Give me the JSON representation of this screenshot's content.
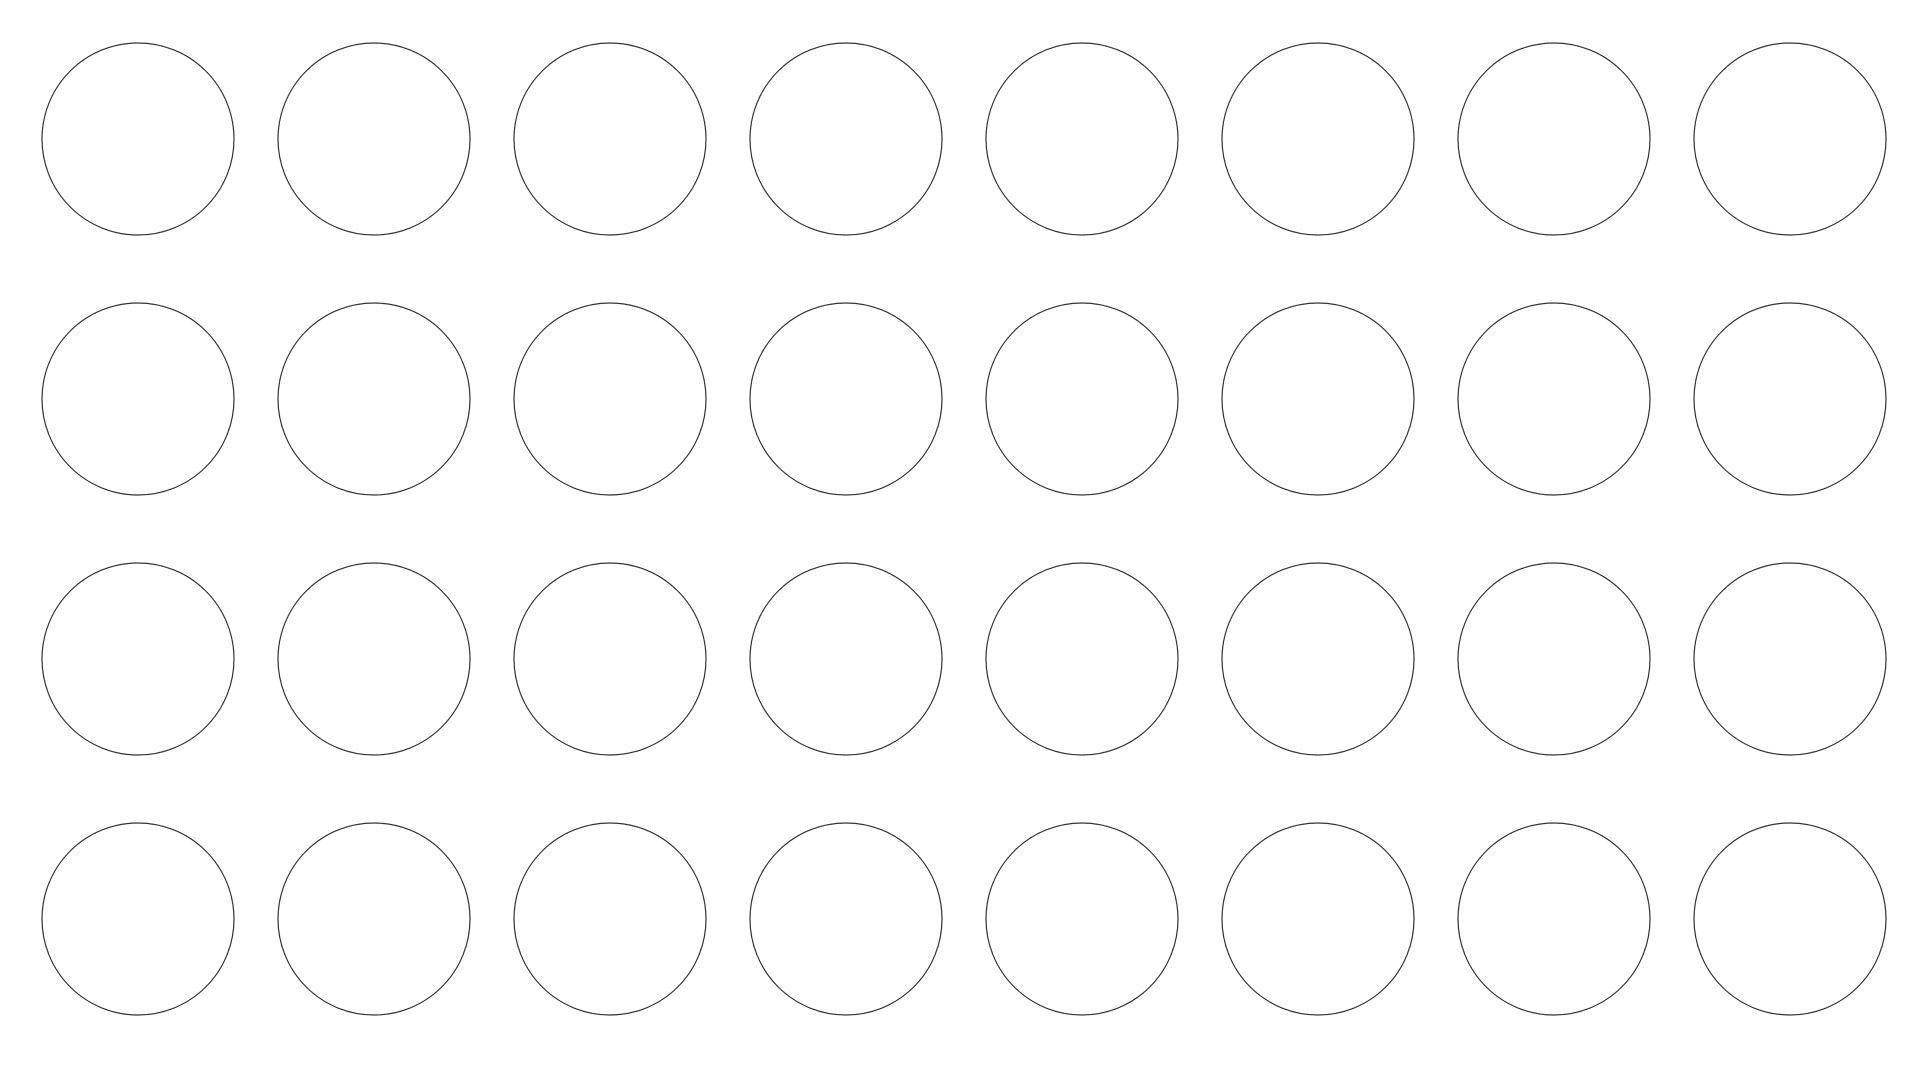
{
  "grid": {
    "rows": 4,
    "columns": 8,
    "stroke_color": "#333333",
    "background_color": "#ffffff"
  }
}
